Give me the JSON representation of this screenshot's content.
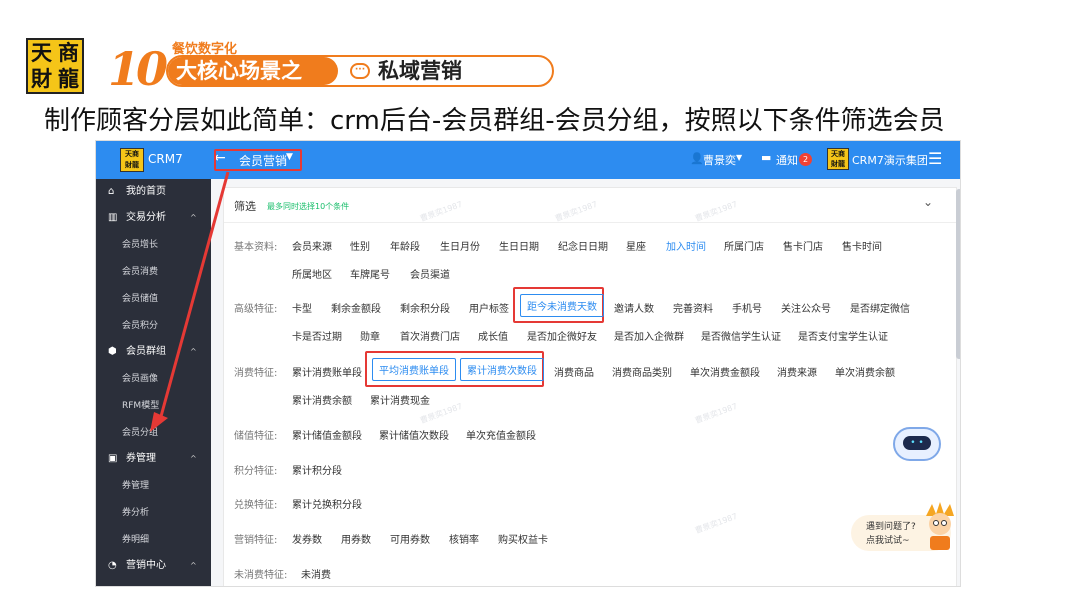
{
  "slide": {
    "logo_chars": [
      "天",
      "商",
      "財",
      "龍"
    ],
    "ten_number": "10",
    "banner_sub": "餐饮数字化",
    "banner_left": "大核心场景之",
    "banner_right": "私域营销",
    "title": "制作顾客分层如此简单：crm后台-会员群组-会员分组，按照以下条件筛选会员",
    "accent_color": "#f07c1d"
  },
  "app": {
    "name": "CRM7",
    "module": "会员营销",
    "user": "曹景奕",
    "notify_label": "通知",
    "notify_count": "2",
    "org": "CRM7演示集团",
    "primary_color": "#2d8cf0",
    "sidebar_color": "#2b2f3a"
  },
  "sidebar": {
    "home": "我的首页",
    "trade": "交易分析",
    "trade_items": [
      "会员增长",
      "会员消费",
      "会员储值",
      "会员积分"
    ],
    "groups": "会员群组",
    "group_items": [
      "会员画像",
      "RFM模型",
      "会员分组"
    ],
    "coupon": "券管理",
    "coupon_items": [
      "券管理",
      "券分析",
      "券明细"
    ],
    "marketing": "营销中心"
  },
  "filter": {
    "title": "筛选",
    "hint": "最多同时选择10个条件",
    "basic_label": "基本资料:",
    "basic_row1": [
      "会员来源",
      "性别",
      "年龄段",
      "生日月份",
      "生日日期",
      "纪念日日期",
      "星座",
      "加入时间",
      "所属门店",
      "售卡门店",
      "售卡时间"
    ],
    "basic_row2": [
      "所属地区",
      "车牌尾号",
      "会员渠道"
    ],
    "advanced_label": "高级特征:",
    "advanced_row1": [
      "卡型",
      "剩余金额段",
      "剩余积分段",
      "用户标签",
      "距今未消费天数",
      "邀请人数",
      "完善资料",
      "手机号",
      "关注公众号",
      "是否绑定微信"
    ],
    "advanced_row2": [
      "卡是否过期",
      "勋章",
      "首次消费门店",
      "成长值",
      "是否加企微好友",
      "是否加入企微群",
      "是否微信学生认证",
      "是否支付宝学生认证"
    ],
    "consume_label": "消费特征:",
    "consume_row1": [
      "累计消费账单段",
      "平均消费账单段",
      "累计消费次数段",
      "消费商品",
      "消费商品类别",
      "单次消费金额段",
      "消费来源",
      "单次消费余额"
    ],
    "consume_row2": [
      "累计消费余额",
      "累计消费现金"
    ],
    "stored_label": "储值特征:",
    "stored_row": [
      "累计储值金额段",
      "累计储值次数段",
      "单次充值金额段"
    ],
    "points_label": "积分特征:",
    "points_row": [
      "累计积分段"
    ],
    "redeem_label": "兑换特征:",
    "redeem_row": [
      "累计兑换积分段"
    ],
    "marketing_label": "营销特征:",
    "marketing_row": [
      "发券数",
      "用券数",
      "可用券数",
      "核销率",
      "购买权益卡"
    ],
    "noconsume_label": "未消费特征:",
    "noconsume_row": [
      "未消费"
    ]
  },
  "assistant": {
    "line1": "遇到问题了?",
    "line2": "点我试试~"
  },
  "watermark_text": "曹景奕1987"
}
